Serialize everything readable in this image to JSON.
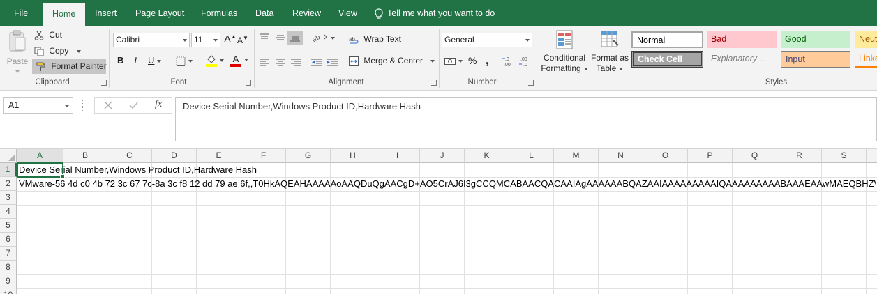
{
  "menu": {
    "tabs": [
      "File",
      "Home",
      "Insert",
      "Page Layout",
      "Formulas",
      "Data",
      "Review",
      "View"
    ],
    "active_tab": "Home",
    "tell_me": "Tell me what you want to do"
  },
  "clipboard": {
    "paste": "Paste",
    "cut": "Cut",
    "copy": "Copy",
    "format_painter": "Format Painter",
    "label": "Clipboard"
  },
  "font": {
    "name": "Calibri",
    "size": "11",
    "bold": "B",
    "italic": "I",
    "underline": "U",
    "grow": "A",
    "shrink": "A",
    "font_color_letter": "A",
    "label": "Font"
  },
  "alignment": {
    "wrap_text": "Wrap Text",
    "merge_center": "Merge & Center",
    "label": "Alignment"
  },
  "number": {
    "format": "General",
    "currency": "$",
    "percent": "%",
    "comma": ",",
    "label": "Number"
  },
  "styles_group": {
    "conditional_formatting": [
      "Conditional",
      "Formatting"
    ],
    "format_as_table": [
      "Format as",
      "Table"
    ],
    "gallery": {
      "normal": "Normal",
      "bad": "Bad",
      "good": "Good",
      "neutral": "Neut",
      "check_cell": "Check Cell",
      "explanatory": "Explanatory ...",
      "input": "Input",
      "linked": "Linke"
    },
    "label": "Styles"
  },
  "formula_bar": {
    "name_box": "A1",
    "fx": "fx",
    "content": "Device Serial Number,Windows Product ID,Hardware Hash"
  },
  "sheet": {
    "columns": [
      "A",
      "B",
      "C",
      "D",
      "E",
      "F",
      "G",
      "H",
      "I",
      "J",
      "K",
      "L",
      "M",
      "N",
      "O",
      "P",
      "Q",
      "R",
      "S"
    ],
    "rows": [
      "1",
      "2",
      "3",
      "4",
      "5",
      "6",
      "7",
      "8",
      "9",
      "10"
    ],
    "selected_column": "A",
    "selected_row": "1",
    "cells": {
      "A1": "Device Serial Number,Windows Product ID,Hardware Hash",
      "A2": "VMware-56 4d c0 4b 72 3c 67 7c-8a 3c f8 12 dd 79 ae 6f,,T0HkAQEAHAAAAAoAAQDuQgAACgD+AO5CrAJ6I3gCCQMCABAACQACAAIAgAAAAAABQAZAAIAAAAAAAAAIQAAAAAAAAABAAAEAAwMAEQBHZV"
    }
  },
  "colors": {
    "accent": "#217346",
    "ribbon_bg": "#f3f3f3"
  }
}
